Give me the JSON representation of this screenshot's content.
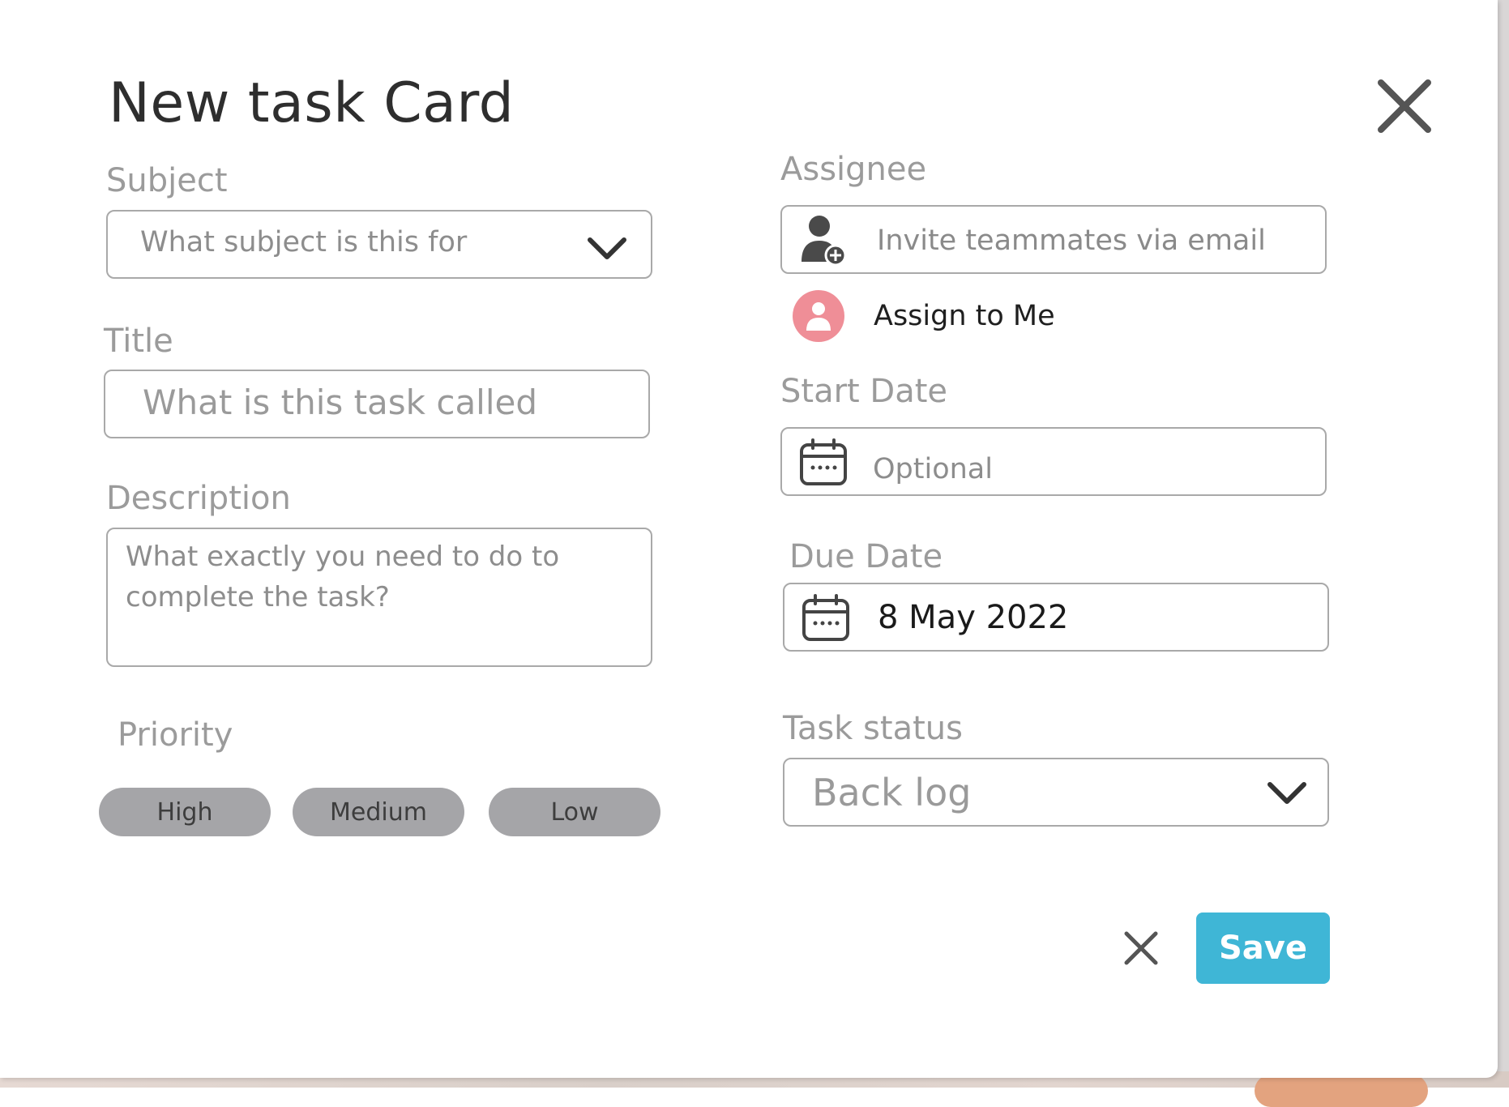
{
  "modal": {
    "title": "New task Card",
    "subject": {
      "label": "Subject",
      "placeholder": "What subject is this for"
    },
    "title_field": {
      "label": "Title",
      "placeholder": "What is this task called"
    },
    "description": {
      "label": "Description",
      "placeholder_line1": "What exactly you need to do to",
      "placeholder_line2": "complete the task?"
    },
    "priority": {
      "label": "Priority",
      "options": [
        "High",
        "Medium",
        "Low"
      ]
    },
    "assignee": {
      "label": "Assignee",
      "placeholder": "Invite teammates via email",
      "assign_me": "Assign to Me"
    },
    "start_date": {
      "label": "Start Date",
      "placeholder": "Optional"
    },
    "due_date": {
      "label": "Due Date",
      "value": "8 May 2022"
    },
    "task_status": {
      "label": "Task status",
      "value": "Back log"
    },
    "actions": {
      "save_label": "Save"
    }
  },
  "colors": {
    "accent": "#3fb6d6",
    "avatar": "#ef8e97",
    "pill": "#a5a5a8",
    "label": "#9b9b9b"
  },
  "icons": {
    "close": "close-icon",
    "chevron": "chevron-down-icon",
    "add_user": "add-user-icon",
    "calendar": "calendar-icon",
    "user": "user-icon"
  }
}
